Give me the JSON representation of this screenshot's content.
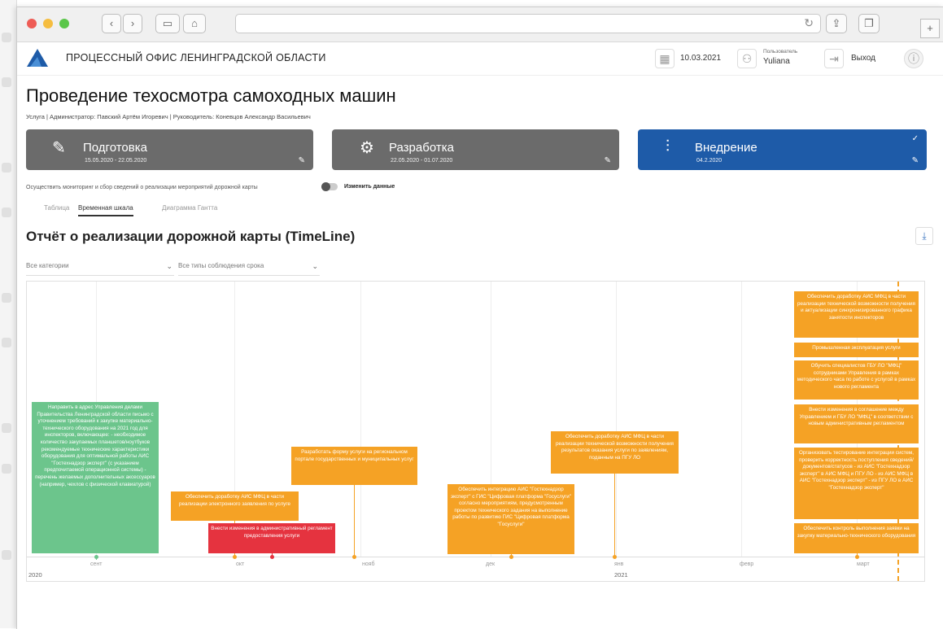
{
  "browser": {
    "tab_plus": "+"
  },
  "header": {
    "org_name": "ПРОЦЕССНЫЙ ОФИС ЛЕНИНГРАДСКОЙ ОБЛАСТИ",
    "date": "10.03.2021",
    "user_label": "Пользователь",
    "user_name": "Yuliana",
    "logout": "Выход"
  },
  "page": {
    "title": "Проведение техосмотра самоходных машин",
    "meta": "Услуга  |  Администратор: Павский Артём Игоревич  |  Руководитель: Коневцов Александр Васильевич"
  },
  "stages": [
    {
      "name": "Подготовка",
      "dates": "15.05.2020 - 22.05.2020",
      "icon": "pencil-icon",
      "color": "#6b6b6b"
    },
    {
      "name": "Разработка",
      "dates": "22.05.2020 - 01.07.2020",
      "icon": "gear-icon",
      "color": "#6b6b6b"
    },
    {
      "name": "Внедрение",
      "dates": "04.2.2020",
      "icon": "sliders-icon",
      "color": "#1e5ba8"
    }
  ],
  "toggle": {
    "description": "Осуществить мониторинг и сбор сведений о реализации мероприятий дорожной карты",
    "label": "Изменить данные"
  },
  "tabs": [
    "Таблица",
    "Временная шкала",
    "Диаграмма Гантта"
  ],
  "report": {
    "title": "Отчёт о реализации дорожной карты (TimeLine)",
    "filter_category": "Все категории",
    "filter_deadline": "Все типы соблюдения срока"
  },
  "timeline": {
    "months": [
      "сент",
      "окт",
      "нояб",
      "дек",
      "янв",
      "февр",
      "март"
    ],
    "years": [
      "2020",
      "2021"
    ],
    "events": [
      {
        "text": "Направить в адрес Управления делами Правительства Ленинградской области письмо с уточнением требований к закупке материально-технического оборудования на 2021 год для инспекторов, включающее: - необходимое количество закупаемых планшетов/ноутбуков рекомендуемые технические характеристики оборудования для оптимальной работы АИС \"Гостехнадзор эксперт\" (с указанием предпочитаемой операционной системы) - перечень желаемых дополнительных аксессуаров (например, чехлов с физической клавиатурой)",
        "color": "#6cc58c"
      },
      {
        "text": "Обеспечить доработку АИС МФЦ в части реализации электронного заявления по услуге",
        "color": "#f5a225"
      },
      {
        "text": "Внести изменения в административный регламент предоставления услуги",
        "color": "#e5333f"
      },
      {
        "text": "Разработать форму услуги на региональном портале государственных и муниципальных услуг",
        "color": "#f5a225"
      },
      {
        "text": "Обеспечить интеграцию АИС \"Гостехнадзор эксперт\" с ГИС \"Цифровая платформа \"Госуслуги\" согласно мероприятиям, предусмотренным проектом технического задания на выполнение работы по развитию ГИС \"Цифровая платформа \"Госуслуги\"",
        "color": "#f5a225"
      },
      {
        "text": "Обеспечить доработку АИС МФЦ в части реализации технической возможности получения результатов оказания услуги по заявлениям, поданным на ПГУ ЛО",
        "color": "#f5a225"
      },
      {
        "text": "Обеспечить доработку АИС МФЦ в части реализации технической возможности получения и актуализации синхронизированного графика занятости инспекторов",
        "color": "#f5a225"
      },
      {
        "text": "Промышленная эксплуатация услуги",
        "color": "#f5a225"
      },
      {
        "text": "Обучить специалистов ГБУ ЛО \"МФЦ\" сотрудниками Управления в рамках методического часа по работе с услугой в рамках нового регламента",
        "color": "#f5a225"
      },
      {
        "text": "Внести изменения в соглашение между Управлением и ГБУ ЛО \"МФЦ\" в соответствии с новым административным регламентом",
        "color": "#f5a225"
      },
      {
        "text": "Организовать тестирование интеграции систем, проверить корректность поступления сведений/документов/статусов - из АИС \"Гостехнадзор эксперт\" в АИС МФЦ и ПГУ ЛО - из АИС МФЦ в АИС \"Гостехнадзор эксперт\" - из ПГУ ЛО в АИС \"Гостехнадзор эксперт\"",
        "color": "#f5a225"
      },
      {
        "text": "Обеспечить контроль выполнения заявки на закупку материально-технического оборудования",
        "color": "#f5a225"
      }
    ]
  }
}
